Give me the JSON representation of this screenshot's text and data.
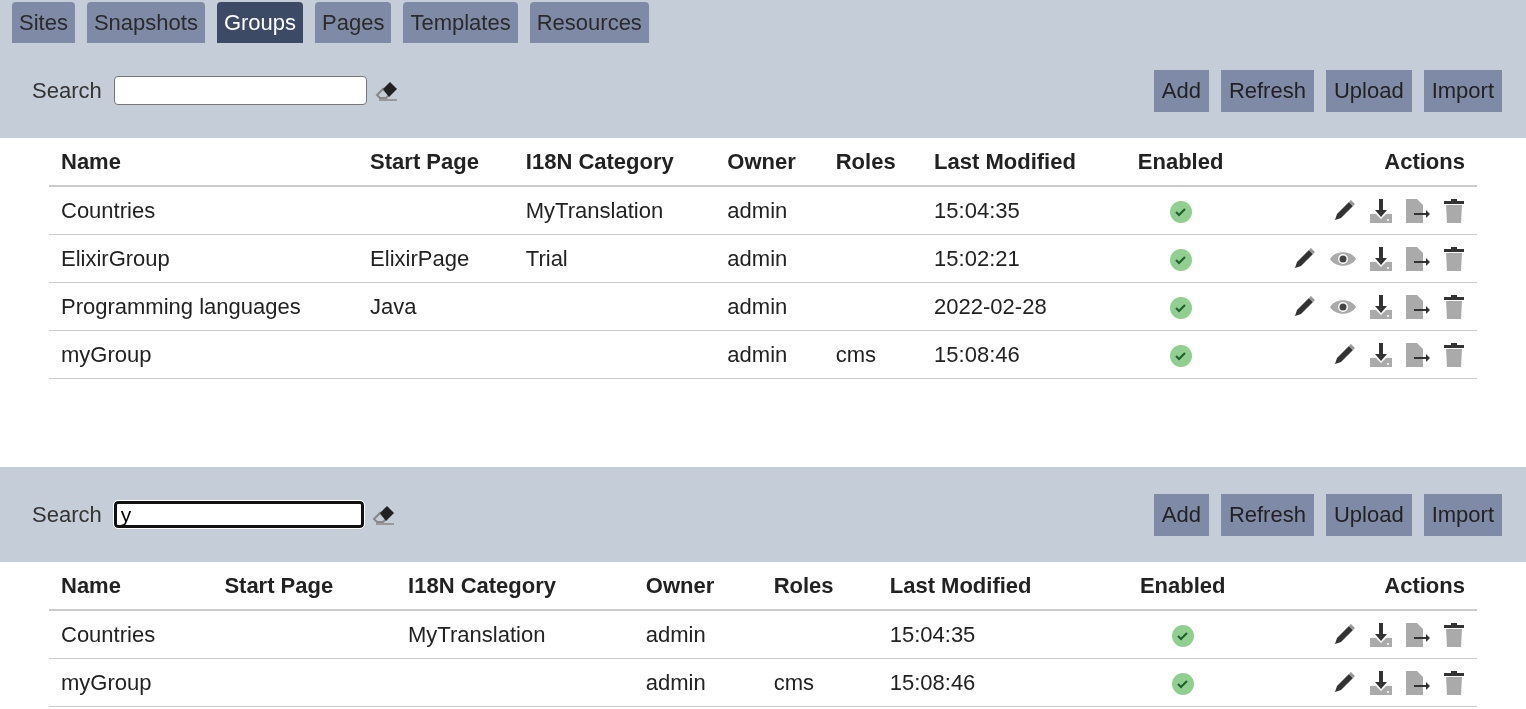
{
  "tabs": [
    {
      "label": "Sites",
      "selected": false
    },
    {
      "label": "Snapshots",
      "selected": false
    },
    {
      "label": "Groups",
      "selected": true
    },
    {
      "label": "Pages",
      "selected": false
    },
    {
      "label": "Templates",
      "selected": false
    },
    {
      "label": "Resources",
      "selected": false
    }
  ],
  "panels": [
    {
      "search": {
        "label": "Search",
        "focused": false
      },
      "buttons": [
        "Add",
        "Refresh",
        "Upload",
        "Import"
      ],
      "table": {
        "columns": [
          "Name",
          "Start Page",
          "I18N Category",
          "Owner",
          "Roles",
          "Last Modified",
          "Enabled",
          "Actions"
        ],
        "rows": [
          {
            "cells": [
              "Countries",
              "",
              "MyTranslation",
              "admin",
              "",
              "15:04:35"
            ],
            "enabled": true,
            "actions": [
              {
                "kind": "edit"
              },
              {
                "kind": "download"
              },
              {
                "kind": "export"
              },
              {
                "kind": "delete"
              }
            ]
          },
          {
            "cells": [
              "ElixirGroup",
              "ElixirPage",
              "Trial",
              "admin",
              "",
              "15:02:21"
            ],
            "enabled": true,
            "actions": [
              {
                "kind": "edit"
              },
              {
                "kind": "view"
              },
              {
                "kind": "download"
              },
              {
                "kind": "export"
              },
              {
                "kind": "delete"
              }
            ]
          },
          {
            "cells": [
              "Programming languages",
              "Java",
              "",
              "admin",
              "",
              "2022-02-28"
            ],
            "enabled": true,
            "actions": [
              {
                "kind": "edit"
              },
              {
                "kind": "view"
              },
              {
                "kind": "download"
              },
              {
                "kind": "export"
              },
              {
                "kind": "delete"
              }
            ]
          },
          {
            "cells": [
              "myGroup",
              "",
              "",
              "admin",
              "cms",
              "15:08:46"
            ],
            "enabled": true,
            "actions": [
              {
                "kind": "edit"
              },
              {
                "kind": "download"
              },
              {
                "kind": "export"
              },
              {
                "kind": "delete"
              }
            ]
          }
        ]
      }
    },
    {
      "search": {
        "label": "Search",
        "value": "y",
        "focused": true
      },
      "buttons": [
        "Add",
        "Refresh",
        "Upload",
        "Import"
      ],
      "table": {
        "columns": [
          "Name",
          "Start Page",
          "I18N Category",
          "Owner",
          "Roles",
          "Last Modified",
          "Enabled",
          "Actions"
        ],
        "rows": [
          {
            "cells": [
              "Countries",
              "",
              "MyTranslation",
              "admin",
              "",
              "15:04:35"
            ],
            "enabled": true,
            "actions": [
              {
                "kind": "edit"
              },
              {
                "kind": "download"
              },
              {
                "kind": "export"
              },
              {
                "kind": "delete"
              }
            ]
          },
          {
            "cells": [
              "myGroup",
              "",
              "",
              "admin",
              "cms",
              "15:08:46"
            ],
            "enabled": true,
            "actions": [
              {
                "kind": "edit"
              },
              {
                "kind": "download"
              },
              {
                "kind": "export"
              },
              {
                "kind": "delete"
              }
            ]
          }
        ]
      }
    }
  ]
}
